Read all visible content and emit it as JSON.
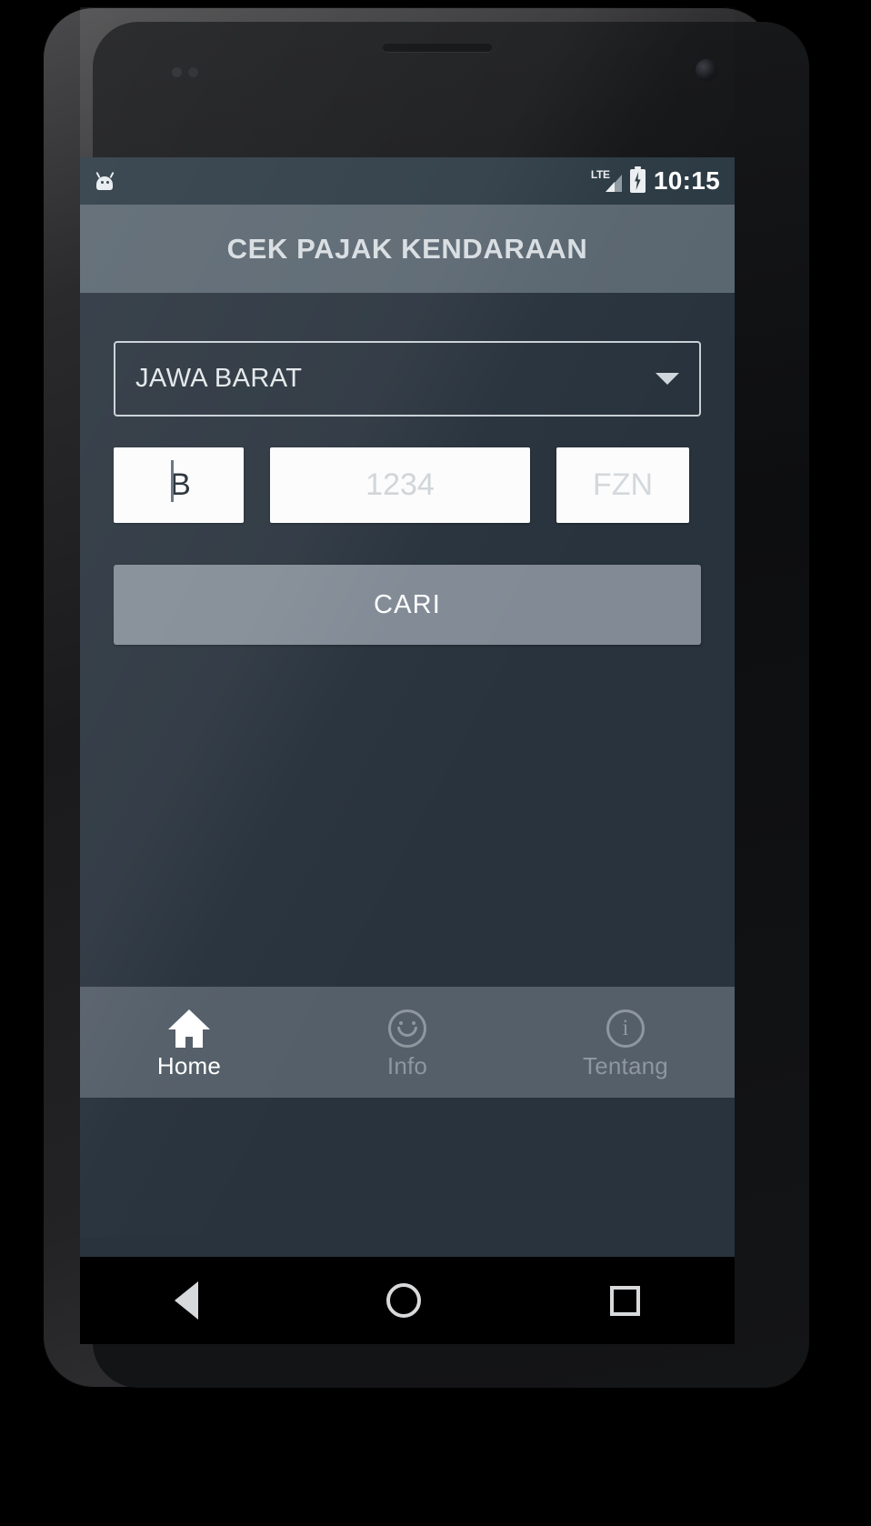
{
  "device": {
    "type": "android-phone-mockup"
  },
  "status_bar": {
    "notification_icon": "android-robot-icon",
    "network_label": "LTE",
    "signal_icon": "signal-bars-icon",
    "battery_icon": "battery-charging-icon",
    "clock": "10:15"
  },
  "app_bar": {
    "title": "CEK PAJAK KENDARAAN"
  },
  "form": {
    "province_spinner": {
      "value": "JAWA BARAT",
      "caret_icon": "chevron-down-icon"
    },
    "plate": {
      "prefix": {
        "value": "B",
        "placeholder": "B"
      },
      "number": {
        "value": "",
        "placeholder": "1234"
      },
      "suffix": {
        "value": "",
        "placeholder": "FZN"
      }
    },
    "submit_label": "CARI"
  },
  "tab_bar": {
    "items": [
      {
        "label": "Home",
        "icon": "home-icon",
        "active": true
      },
      {
        "label": "Info",
        "icon": "smiley-icon",
        "active": false
      },
      {
        "label": "Tentang",
        "icon": "info-circle-icon",
        "active": false
      }
    ]
  },
  "system_nav": {
    "back": "back-triangle-icon",
    "home": "home-circle-icon",
    "recents": "recents-square-icon"
  },
  "colors": {
    "app_bar": "#5a6670",
    "status_bar": "#2c3a44",
    "screen_bg": "#29333d",
    "button": "#828b95",
    "tab_bar": "#555f69",
    "accent_text": "#ffffff",
    "muted_text": "#8e979f"
  }
}
